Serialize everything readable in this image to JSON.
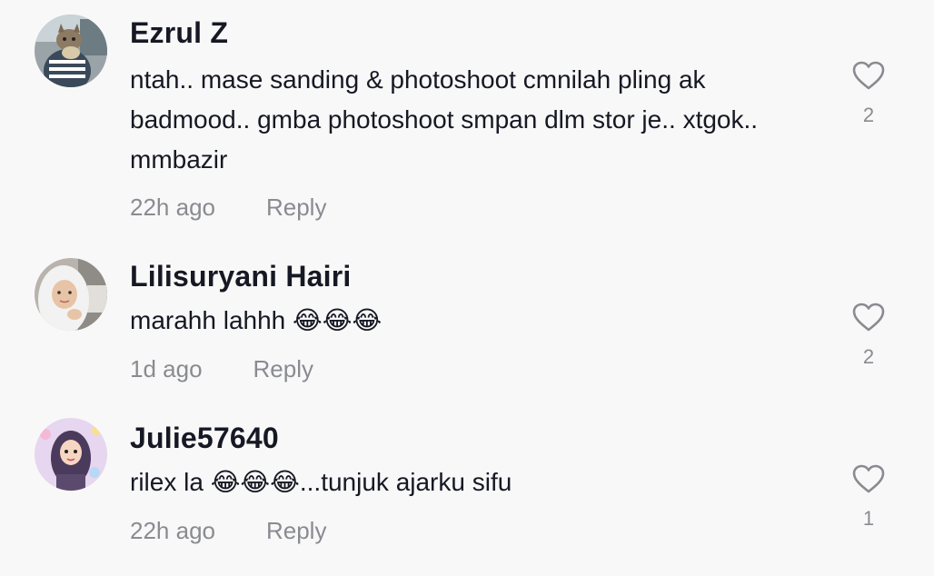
{
  "comments": [
    {
      "username": "Ezrul Z",
      "text": "ntah.. mase sanding & photoshoot cmnilah pling ak badmood.. gmba photoshoot smpan dlm stor je.. xtgok.. mmbazir",
      "time": "22h ago",
      "reply_label": "Reply",
      "likes": "2",
      "avatar_icon": "cat-avatar-photo"
    },
    {
      "username": "Lilisuryani Hairi",
      "text_before": "marahh lahhh",
      "emojis": "😂😂😂",
      "text_after": "",
      "time": "1d ago",
      "reply_label": "Reply",
      "likes": "2",
      "avatar_icon": "hijab-woman-avatar-photo"
    },
    {
      "username": "Julie57640",
      "text_before": "rilex la",
      "emojis": "😂😂😂",
      "text_after": "...tunjuk ajarku sifu",
      "time": "22h ago",
      "reply_label": "Reply",
      "likes": "1",
      "avatar_icon": "cartoon-hijab-avatar"
    }
  ],
  "colors": {
    "background": "#f8f8f8",
    "primary_text": "#161823",
    "secondary_text": "#8a8b91",
    "heart_outline": "#8a8b91"
  }
}
